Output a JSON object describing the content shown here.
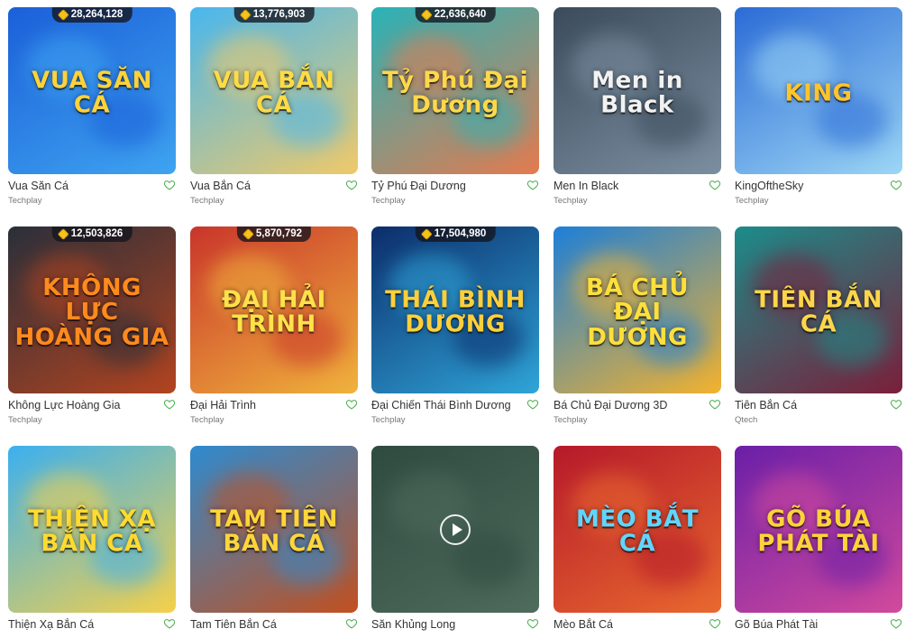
{
  "games": [
    {
      "name": "Vua Săn Cá",
      "provider": "Techplay",
      "jackpot": "28,264,128",
      "art_title": "VUA SĂN CÁ",
      "colors": [
        "#1b5fd9",
        "#3fa4f0"
      ],
      "title_color": "#ffd23a"
    },
    {
      "name": "Vua Bắn Cá",
      "provider": "Techplay",
      "jackpot": "13,776,903",
      "art_title": "VUA BẮN CÁ",
      "colors": [
        "#48b7ef",
        "#f0c969"
      ],
      "title_color": "#ffdb45"
    },
    {
      "name": "Tỷ Phú Đại Dương",
      "provider": "Techplay",
      "jackpot": "22,636,640",
      "art_title": "Tỷ Phú Đại Dương",
      "colors": [
        "#29b3b8",
        "#e57a4e"
      ],
      "title_color": "#ffd84a"
    },
    {
      "name": "Men In Black",
      "provider": "Techplay",
      "jackpot": "",
      "art_title": "Men in Black",
      "colors": [
        "#3b4b5b",
        "#7c8fa1"
      ],
      "title_color": "#f2f2f2"
    },
    {
      "name": "KingOftheSky",
      "provider": "Techplay",
      "jackpot": "",
      "art_title": "KING",
      "colors": [
        "#2b6bd6",
        "#9cd6f5"
      ],
      "title_color": "#ffc42b"
    },
    {
      "name": "Không Lực Hoàng Gia",
      "provider": "Techplay",
      "jackpot": "12,503,826",
      "art_title": "KHÔNG LỰC HOÀNG GIA",
      "colors": [
        "#2a2f3a",
        "#b24420"
      ],
      "title_color": "#ff8a1d"
    },
    {
      "name": "Đại Hải Trình",
      "provider": "Techplay",
      "jackpot": "5,870,792",
      "art_title": "ĐẠI HẢI TRÌNH",
      "colors": [
        "#c9352b",
        "#f0b33c"
      ],
      "title_color": "#ffe14a"
    },
    {
      "name": "Đại Chiến Thái Bình Dương",
      "provider": "Techplay",
      "jackpot": "17,504,980",
      "art_title": "THÁI BÌNH DƯƠNG",
      "colors": [
        "#0c2d6b",
        "#2fa5d8"
      ],
      "title_color": "#ffcf3a"
    },
    {
      "name": "Bá Chủ Đại Dương 3D",
      "provider": "Techplay",
      "jackpot": "",
      "art_title": "BÁ CHỦ ĐẠI DƯƠNG",
      "colors": [
        "#1d7fd8",
        "#f3b22e"
      ],
      "title_color": "#ffdf3b"
    },
    {
      "name": "Tiên Bắn Cá",
      "provider": "Qtech",
      "jackpot": "",
      "art_title": "TIÊN BẮN CÁ",
      "colors": [
        "#1c8c8a",
        "#7b1f3a"
      ],
      "title_color": "#ffd64a"
    },
    {
      "name": "Thiện Xạ Bắn Cá",
      "provider": "",
      "jackpot": "",
      "art_title": "THIỆN XẠ BẮN CÁ",
      "colors": [
        "#3bb0f0",
        "#f5d04a"
      ],
      "title_color": "#ffda30"
    },
    {
      "name": "Tam Tiên Bắn Cá",
      "provider": "",
      "jackpot": "",
      "art_title": "TAM TIÊN BẮN CÁ",
      "colors": [
        "#2e8bd0",
        "#c2501f"
      ],
      "title_color": "#ffd53a"
    },
    {
      "name": "Săn Khủng Long",
      "provider": "",
      "jackpot": "",
      "art_title": "",
      "colors": [
        "#2f4a3f",
        "#4f6b5c"
      ],
      "title_color": "#ffffff"
    },
    {
      "name": "Mèo Bắt Cá",
      "provider": "",
      "jackpot": "",
      "art_title": "MÈO BẮT CÁ",
      "colors": [
        "#b5192a",
        "#e9692f"
      ],
      "title_color": "#5fd6ff"
    },
    {
      "name": "Gõ Búa Phát Tài",
      "provider": "",
      "jackpot": "",
      "art_title": "GÕ BÚA PHÁT TÀI",
      "colors": [
        "#6a1fa8",
        "#d24a9c"
      ],
      "title_color": "#ffd23a"
    }
  ]
}
